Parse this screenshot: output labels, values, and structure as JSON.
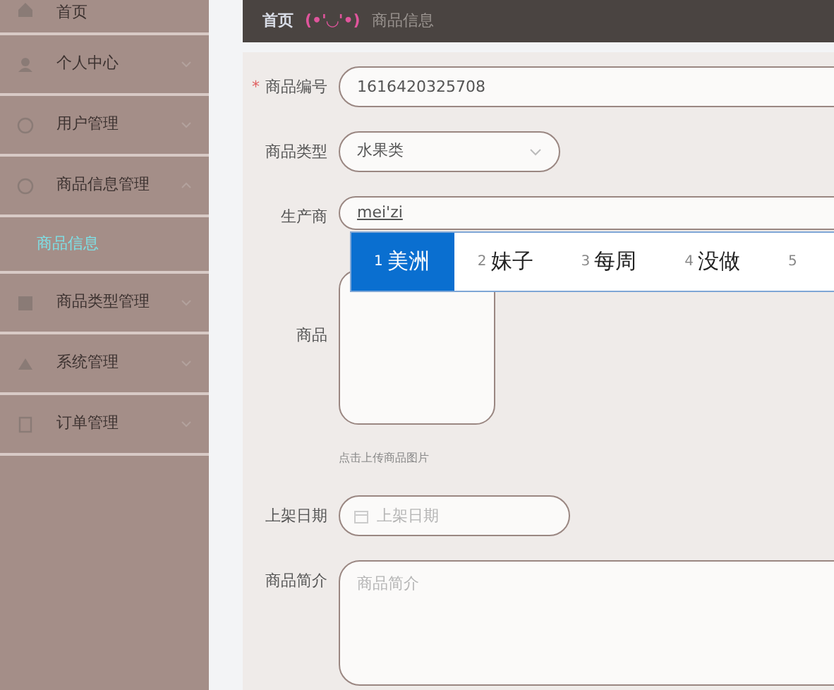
{
  "sidebar": {
    "items": [
      {
        "label": "首页",
        "selected": false,
        "expandable": false
      },
      {
        "label": "个人中心",
        "selected": false,
        "expandable": true
      },
      {
        "label": "用户管理",
        "selected": false,
        "expandable": true
      },
      {
        "label": "商品信息管理",
        "selected": false,
        "expandable": true,
        "expanded": true,
        "children": [
          {
            "label": "商品信息",
            "selected": true
          }
        ]
      },
      {
        "label": "商品类型管理",
        "selected": false,
        "expandable": true
      },
      {
        "label": "系统管理",
        "selected": false,
        "expandable": true
      },
      {
        "label": "订单管理",
        "selected": false,
        "expandable": true
      }
    ]
  },
  "breadcrumb": {
    "home": "首页",
    "separator": "(•'◡'•)",
    "current": "商品信息"
  },
  "form": {
    "fields": [
      {
        "kind": "text",
        "label": "商品编号",
        "required_mark": "*",
        "value": "1616420325708"
      },
      {
        "kind": "select",
        "label": "商品类型",
        "value": "水果类"
      },
      {
        "kind": "composing",
        "label": "生产商",
        "value": "mei'zi"
      },
      {
        "kind": "image",
        "label": "商品",
        "hint": "点击上传商品图片"
      },
      {
        "kind": "date",
        "label": "上架日期",
        "placeholder": "上架日期"
      },
      {
        "kind": "textarea",
        "label": "商品简介",
        "placeholder": "商品简介"
      }
    ]
  },
  "ime": {
    "candidates": [
      {
        "index": "1",
        "word": "美洲",
        "selected": true
      },
      {
        "index": "2",
        "word": "妹子",
        "selected": false
      },
      {
        "index": "3",
        "word": "每周",
        "selected": false
      },
      {
        "index": "4",
        "word": "没做",
        "selected": false
      },
      {
        "index": "5",
        "selected": false
      }
    ]
  }
}
